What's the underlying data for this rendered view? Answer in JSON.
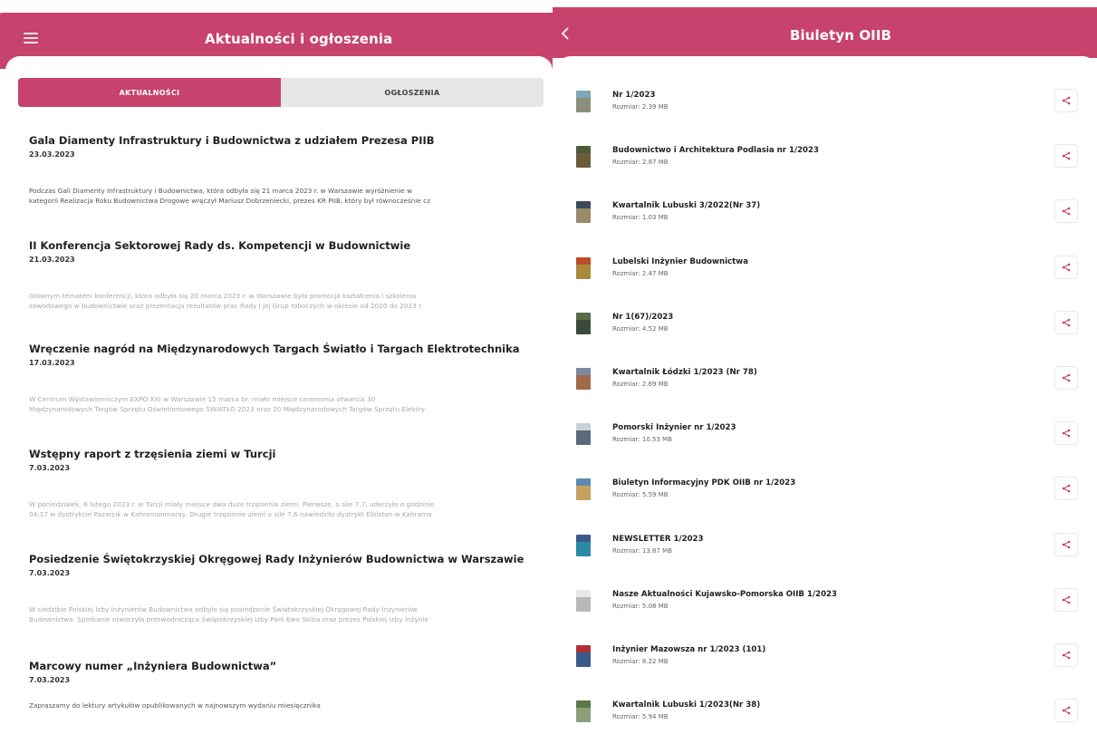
{
  "colors": {
    "accent": "#c7426c",
    "tab_inactive": "#e6e6e6"
  },
  "left": {
    "header": {
      "title": "Aktualności i ogłoszenia",
      "menu_icon": "hamburger-menu-icon"
    },
    "tabs": [
      {
        "label": "AKTUALNOŚCI",
        "active": true
      },
      {
        "label": "OGŁOSZENIA",
        "active": false
      }
    ],
    "news": [
      {
        "title": "Gala Diamenty Infrastruktury i Budownictwa z udziałem Prezesa PIIB",
        "date": "23.03.2023",
        "excerpt_1": "Podczas Gali Diamenty Infrastruktury i Budownictwa, która odbyła się 21 marca 2023 r. w Warszawie wyróżnienie w",
        "excerpt_2": "kategorii Realizacja Roku Budownictwa Drogowe wręczył Mariusz Dobrzeniecki, prezes KR PIIB, który był równocześnie cz"
      },
      {
        "title": "II Konferencja Sektorowej Rady ds. Kompetencji w Budownictwie",
        "date": "21.03.2023",
        "excerpt_1": "Głównym tematem konferencji, która odbyła się 20 marca 2023 r. w Warszawie była promocja kształcenia i szkolenia",
        "excerpt_2": "zawodowego w budownictwie oraz prezentacja rezultatów prac Rady i jej Grup roboczych w okresie od 2020 do 2023 r."
      },
      {
        "title": "Wręczenie nagród na Międzynarodowych Targach Światło i Targach Elektrotechnika",
        "date": "17.03.2023",
        "excerpt_1": "W Centrum Wystawienniczym EXPO XXI w Warszawie 15 marca br. miało miejsce ceremonia otwarcia 30",
        "excerpt_2": "Międzynarodowych Targów Sprzętu Oświetleniowego ŚWIATŁO 2023 oraz 20 Międzynarodowych Targów Sprzętu Elektry"
      },
      {
        "title": "Wstępny raport z trzęsienia ziemi w Turcji",
        "date": "7.03.2023",
        "excerpt_1": "W poniedziałek, 6 lutego 2023 r. w Turcji miały miejsce dwa duże trzęsienia ziemi. Pierwsze, o sile 7.7, uderzyło o godzinie",
        "excerpt_2": "04:17 w dystrykcie Pazarcık w Kahramanmaraş. Drugie trzęsienie ziemi o sile 7,6 nawiedziło dystrykt Elbistan w Kahrama"
      },
      {
        "title": "Posiedzenie Świętokrzyskiej Okręgowej Rady Inżynierów Budownictwa w Warszawie",
        "date": "7.03.2023",
        "excerpt_1": "W siedzibie Polskiej Izby Inżynierów Budownictwa odbyło się posiedzenie Świętokrzyskiej Okręgowej Rady Inżynierów",
        "excerpt_2": "Budownictwa. Spotkanie otworzyła przewodnicząca Świętokrzyskiej Izby Pani Ewa Skiba oraz prezes Polskiej Izby Inżynie"
      },
      {
        "title": "Marcowy numer „Inżyniera Budownictwa”",
        "date": "7.03.2023",
        "excerpt_1": "Zapraszamy do lektury artykułów opublikowanych w najnowszym wydaniu miesięcznika",
        "excerpt_2": ""
      }
    ]
  },
  "right": {
    "header": {
      "title": "Biuletyn OIIB",
      "back_icon": "chevron-left-icon"
    },
    "size_prefix": "Rozmiar:",
    "share_icon": "share-icon",
    "publications": [
      {
        "name": "Nr 1/2023",
        "size": "Rozmiar: 2.39 MB",
        "c1": "#7fa7b8",
        "c2": "#8a8f7a"
      },
      {
        "name": "Budownictwo i Architektura Podlasia nr 1/2023",
        "size": "Rozmiar: 2.87 MB",
        "c1": "#4a5a3a",
        "c2": "#6b5a3c"
      },
      {
        "name": "Kwartalnik Lubuski 3/2022(Nr 37)",
        "size": "Rozmiar: 1.03 MB",
        "c1": "#3b4a5a",
        "c2": "#9a8a6a"
      },
      {
        "name": "Lubelski Inżynier Budownictwa",
        "size": "Rozmiar: 2.47 MB",
        "c1": "#c04a2a",
        "c2": "#a88a3a"
      },
      {
        "name": "Nr 1(67)/2023",
        "size": "Rozmiar: 4.52 MB",
        "c1": "#5a6a4a",
        "c2": "#3a4a3a"
      },
      {
        "name": "Kwartalnik Łódzki 1/2023 (Nr 78)",
        "size": "Rozmiar: 2.69 MB",
        "c1": "#7a8aa0",
        "c2": "#a06a4a"
      },
      {
        "name": "Pomorski Inżynier nr 1/2023",
        "size": "Rozmiar: 10.53 MB",
        "c1": "#c8d2da",
        "c2": "#5a6a7a"
      },
      {
        "name": "Biuletyn Informacyjny PDK OIIB nr 1/2023",
        "size": "Rozmiar: 5.59 MB",
        "c1": "#5a8ab0",
        "c2": "#c8a060"
      },
      {
        "name": "NEWSLETTER 1/2023",
        "size": "Rozmiar: 13.87 MB",
        "c1": "#3a5a8a",
        "c2": "#2a8aa8"
      },
      {
        "name": "Nasze Aktualności Kujawsko-Pomorska OIIB 1/2023",
        "size": "Rozmiar: 5.08 MB",
        "c1": "#e8e8e8",
        "c2": "#b8b8b8"
      },
      {
        "name": "Inżynier Mazowsza nr 1/2023 (101)",
        "size": "Rozmiar: 8.22 MB",
        "c1": "#b0303a",
        "c2": "#3a5a8a"
      },
      {
        "name": "Kwartalnik Lubuski 1/2023(Nr 38)",
        "size": "Rozmiar: 5.94 MB",
        "c1": "#5a7a4a",
        "c2": "#8aa07a"
      }
    ]
  }
}
